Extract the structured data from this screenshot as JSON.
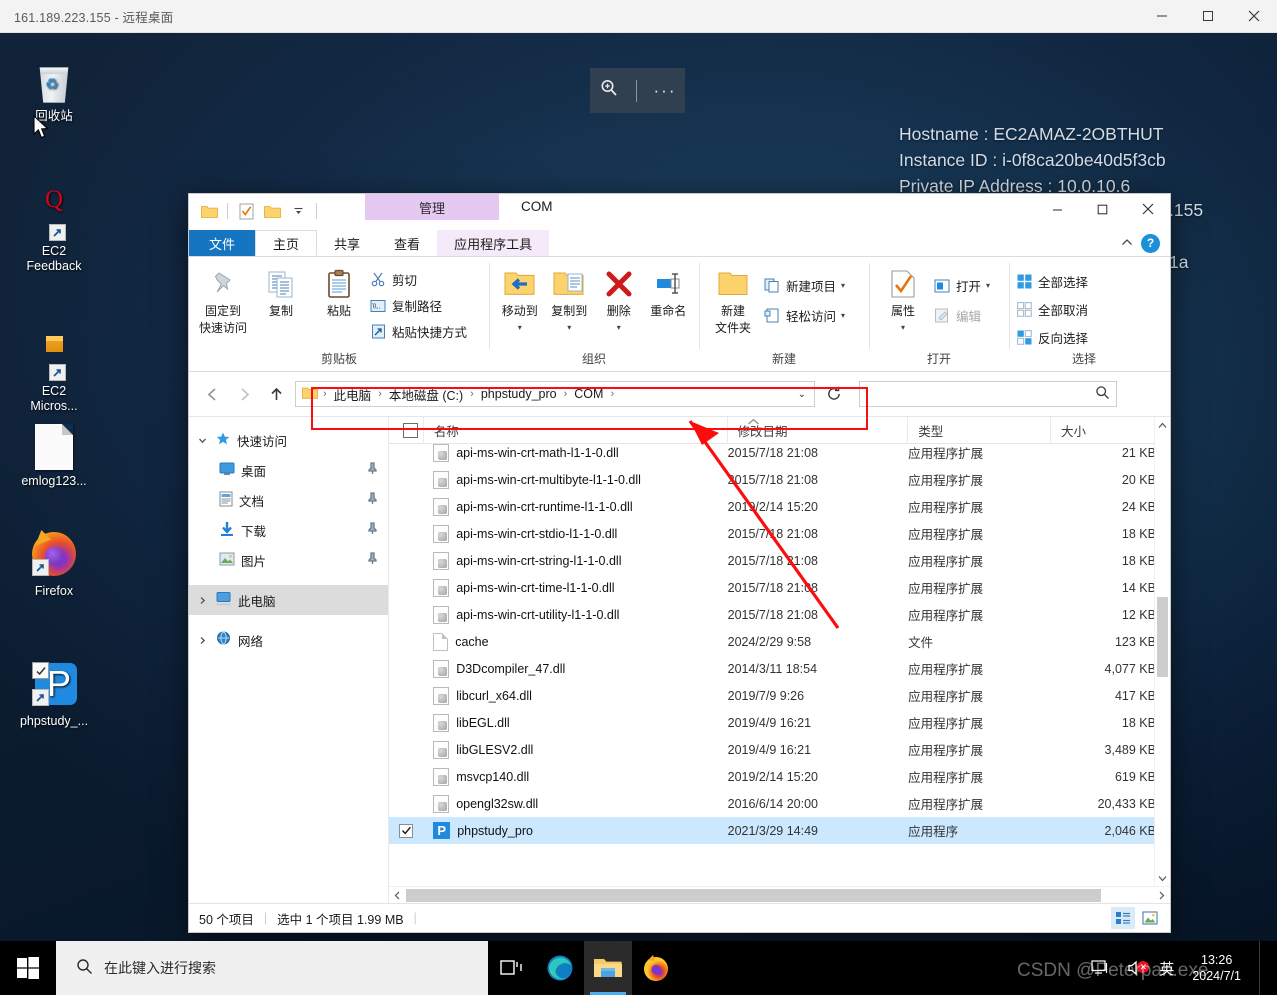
{
  "rdp": {
    "title": "161.189.223.155 - 远程桌面",
    "minimize": "—",
    "maximize": "□",
    "close": "✕"
  },
  "connbar": {
    "zoom_icon": "zoom-in-icon",
    "more": "···"
  },
  "wallpaper": {
    "lines": [
      "Hostname : EC2AMAZ-2OBTHUT",
      "Instance ID : i-0f8ca20be40d5f3cb",
      "Private IP Address : 10.0.10.6"
    ],
    "occluded_right": [
      ".155",
      "1a"
    ]
  },
  "desktop_icons": [
    {
      "name": "回收站",
      "icon": "recycle-bin-icon"
    },
    {
      "name": "EC2\nFeedback",
      "label1": "EC2",
      "label2": "Feedback",
      "icon": "ec2-feedback-icon"
    },
    {
      "name": "EC2 Micros...",
      "label1": "EC2",
      "label2": "Micros...",
      "icon": "ec2-microsoft-icon"
    },
    {
      "name": "emlog123...",
      "label1": "emlog123...",
      "label2": "",
      "icon": "document-icon"
    },
    {
      "name": "Firefox",
      "label1": "Firefox",
      "label2": "",
      "icon": "firefox-icon"
    },
    {
      "name": "phpstudy_...",
      "label1": "phpstudy_...",
      "label2": "",
      "icon": "phpstudy-icon"
    }
  ],
  "explorer": {
    "window_title": "COM",
    "context_tab": "管理",
    "tabs": [
      {
        "id": "file",
        "label": "文件"
      },
      {
        "id": "home",
        "label": "主页"
      },
      {
        "id": "share",
        "label": "共享"
      },
      {
        "id": "view",
        "label": "查看"
      },
      {
        "id": "apptools",
        "label": "应用程序工具"
      }
    ],
    "ribbon_groups": [
      {
        "label": "剪贴板",
        "big": [
          {
            "label1": "固定到",
            "label2": "快速访问",
            "icon": "pin-icon"
          },
          {
            "label1": "复制",
            "label2": "",
            "icon": "copy-icon"
          },
          {
            "label1": "粘贴",
            "label2": "",
            "icon": "paste-icon"
          }
        ],
        "small": [
          {
            "label": "剪切",
            "icon": "scissors-icon"
          },
          {
            "label": "复制路径",
            "icon": "copy-path-icon"
          },
          {
            "label": "粘贴快捷方式",
            "icon": "paste-shortcut-icon"
          }
        ]
      },
      {
        "label": "组织",
        "big": [
          {
            "label1": "移动到",
            "label2": "",
            "icon": "move-to-icon",
            "caret": true
          },
          {
            "label1": "复制到",
            "label2": "",
            "icon": "copy-to-icon",
            "caret": true
          },
          {
            "label1": "删除",
            "label2": "",
            "icon": "delete-icon",
            "caret": true
          },
          {
            "label1": "重命名",
            "label2": "",
            "icon": "rename-icon"
          }
        ],
        "small": []
      },
      {
        "label": "新建",
        "big": [
          {
            "label1": "新建",
            "label2": "文件夹",
            "icon": "new-folder-icon"
          }
        ],
        "small": [
          {
            "label": "新建项目",
            "icon": "new-item-icon",
            "caret": true
          },
          {
            "label": "轻松访问",
            "icon": "easy-access-icon",
            "caret": true
          }
        ]
      },
      {
        "label": "打开",
        "big": [
          {
            "label1": "属性",
            "label2": "",
            "icon": "properties-icon",
            "caret": true
          }
        ],
        "small": [
          {
            "label": "打开",
            "icon": "open-icon",
            "caret": true
          },
          {
            "label": "编辑",
            "icon": "edit-icon",
            "disabled": true
          }
        ]
      },
      {
        "label": "选择",
        "big": [],
        "small": [
          {
            "label": "全部选择",
            "icon": "select-all-icon"
          },
          {
            "label": "全部取消",
            "icon": "select-none-icon"
          },
          {
            "label": "反向选择",
            "icon": "invert-selection-icon"
          }
        ]
      }
    ],
    "address": {
      "back": "←",
      "forward": "→",
      "up": "↑",
      "crumbs": [
        "此电脑",
        "本地磁盘 (C:)",
        "phpstudy_pro",
        "COM"
      ],
      "separator": "›",
      "refresh_icon": "refresh-icon",
      "search_placeholder": "",
      "search_value": ""
    },
    "navpane": [
      {
        "label": "快速访问",
        "icon": "star-icon",
        "level": 0,
        "expanded": true,
        "pin": false
      },
      {
        "label": "桌面",
        "icon": "desktop-icon",
        "level": 1,
        "pin": true
      },
      {
        "label": "文档",
        "icon": "documents-icon",
        "level": 1,
        "pin": true
      },
      {
        "label": "下载",
        "icon": "downloads-icon",
        "level": 1,
        "pin": true
      },
      {
        "label": "图片",
        "icon": "pictures-icon",
        "level": 1,
        "pin": true
      },
      {
        "label": "此电脑",
        "icon": "this-pc-icon",
        "level": 0,
        "selected": true,
        "pin": false
      },
      {
        "label": "网络",
        "icon": "network-icon",
        "level": 0,
        "pin": false
      }
    ],
    "columns": [
      "名称",
      "修改日期",
      "类型",
      "大小"
    ],
    "files": [
      {
        "name": "api-ms-win-crt-math-l1-1-0.dll",
        "date": "2015/7/18 21:08",
        "type": "应用程序扩展",
        "size": "21 KB",
        "icon": "dll-icon"
      },
      {
        "name": "api-ms-win-crt-multibyte-l1-1-0.dll",
        "date": "2015/7/18 21:08",
        "type": "应用程序扩展",
        "size": "20 KB",
        "icon": "dll-icon"
      },
      {
        "name": "api-ms-win-crt-runtime-l1-1-0.dll",
        "date": "2019/2/14 15:20",
        "type": "应用程序扩展",
        "size": "24 KB",
        "icon": "dll-icon"
      },
      {
        "name": "api-ms-win-crt-stdio-l1-1-0.dll",
        "date": "2015/7/18 21:08",
        "type": "应用程序扩展",
        "size": "18 KB",
        "icon": "dll-icon"
      },
      {
        "name": "api-ms-win-crt-string-l1-1-0.dll",
        "date": "2015/7/18 21:08",
        "type": "应用程序扩展",
        "size": "18 KB",
        "icon": "dll-icon"
      },
      {
        "name": "api-ms-win-crt-time-l1-1-0.dll",
        "date": "2015/7/18 21:08",
        "type": "应用程序扩展",
        "size": "14 KB",
        "icon": "dll-icon"
      },
      {
        "name": "api-ms-win-crt-utility-l1-1-0.dll",
        "date": "2015/7/18 21:08",
        "type": "应用程序扩展",
        "size": "12 KB",
        "icon": "dll-icon"
      },
      {
        "name": "cache",
        "date": "2024/2/29 9:58",
        "type": "文件",
        "size": "123 KB",
        "icon": "file-icon"
      },
      {
        "name": "D3Dcompiler_47.dll",
        "date": "2014/3/11 18:54",
        "type": "应用程序扩展",
        "size": "4,077 KB",
        "icon": "dll-icon"
      },
      {
        "name": "libcurl_x64.dll",
        "date": "2019/7/9 9:26",
        "type": "应用程序扩展",
        "size": "417 KB",
        "icon": "dll-icon"
      },
      {
        "name": "libEGL.dll",
        "date": "2019/4/9 16:21",
        "type": "应用程序扩展",
        "size": "18 KB",
        "icon": "dll-icon"
      },
      {
        "name": "libGLESV2.dll",
        "date": "2019/4/9 16:21",
        "type": "应用程序扩展",
        "size": "3,489 KB",
        "icon": "dll-icon"
      },
      {
        "name": "msvcp140.dll",
        "date": "2019/2/14 15:20",
        "type": "应用程序扩展",
        "size": "619 KB",
        "icon": "dll-icon"
      },
      {
        "name": "opengl32sw.dll",
        "date": "2016/6/14 20:00",
        "type": "应用程序扩展",
        "size": "20,433 KB",
        "icon": "dll-icon"
      },
      {
        "name": "phpstudy_pro",
        "date": "2021/3/29 14:49",
        "type": "应用程序",
        "size": "2,046 KB",
        "icon": "phpstudy-icon",
        "selected": true,
        "checked": true
      }
    ],
    "status": {
      "items": "50 个项目",
      "selection": "选中 1 个项目  1.99 MB"
    }
  },
  "taskbar": {
    "search_placeholder": "在此键入进行搜索",
    "icons": [
      "task-view-icon",
      "edge-icon",
      "file-explorer-icon",
      "firefox-icon"
    ],
    "tray": {
      "ime": "英",
      "time": "13:26",
      "date": "2024/7/1"
    }
  },
  "watermark": "CSDN @Peterpan.exe",
  "annotation": {
    "color": "#fb0d0d",
    "shape": "rect+arrow"
  }
}
